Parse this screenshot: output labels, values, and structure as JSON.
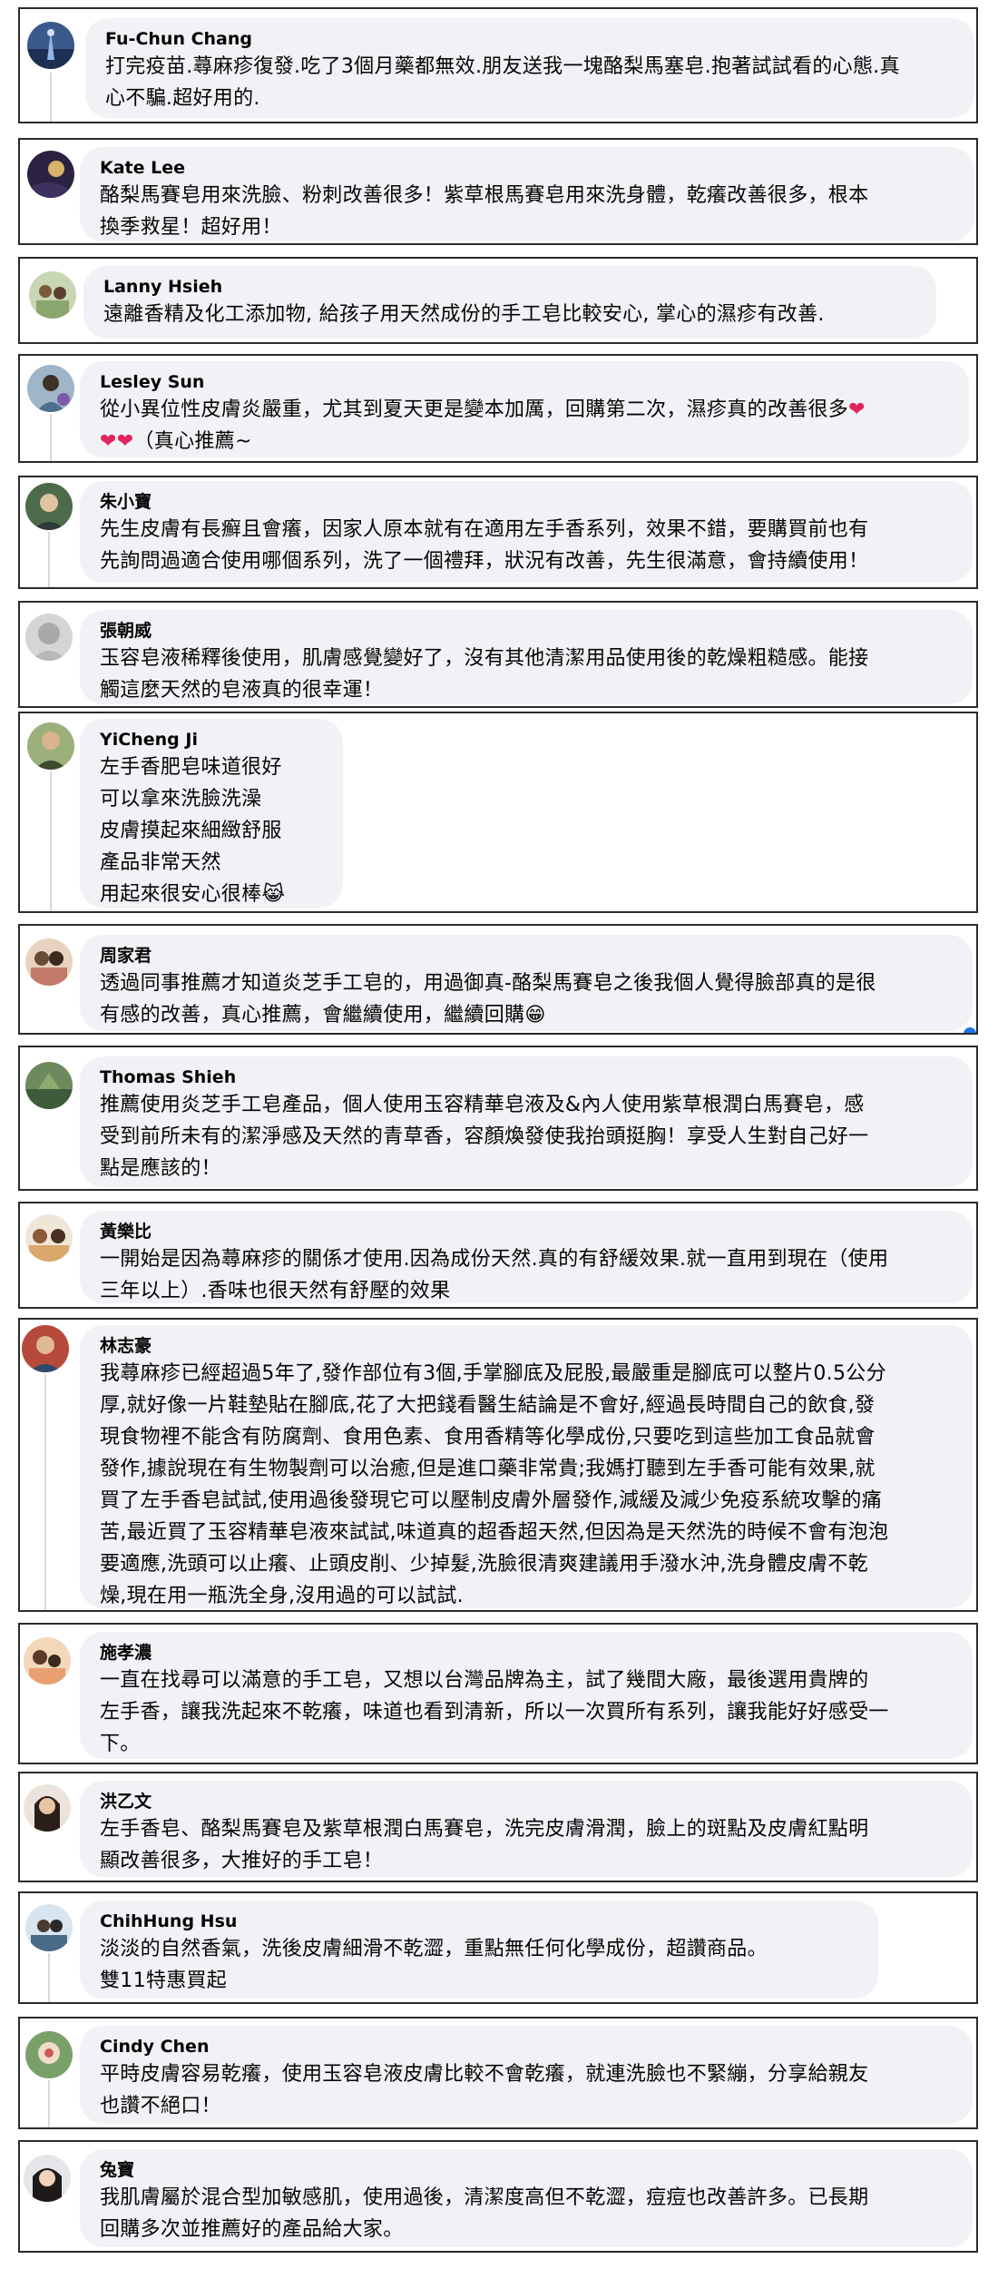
{
  "comments": [
    {
      "author": "Fu-Chun Chang",
      "text": "打完疫苗.蕁麻疹復發.吃了3個月藥都無效.朋友送我一塊酪梨馬塞皂.抱著試試看的心態.真\n心不騙.超好用的."
    },
    {
      "author": "Kate Lee",
      "text": "酪梨馬賽皂用來洗臉、粉刺改善很多！紫草根馬賽皂用來洗身體，乾癢改善很多，根本\n換季救星！超好用！"
    },
    {
      "author": "Lanny Hsieh",
      "text": "遠離香精及化工添加物, 給孩子用天然成份的手工皂比較安心, 掌心的濕疹有改善."
    },
    {
      "author": "Lesley Sun",
      "text": "從小異位性皮膚炎嚴重，尤其到夏天更是變本加厲，回購第二次，濕疹真的改善很多",
      "text2": "（真心推薦~"
    },
    {
      "author": "朱小寶",
      "text": "先生皮膚有長癬且會癢，因家人原本就有在適用左手香系列，效果不錯，要購買前也有\n先詢問過適合使用哪個系列，洗了一個禮拜，狀況有改善，先生很滿意，會持續使用！"
    },
    {
      "author": "張朝威",
      "text": "玉容皂液稀釋後使用，肌膚感覺變好了，沒有其他清潔用品使用後的乾燥粗糙感。能接\n觸這麼天然的皂液真的很幸運！"
    },
    {
      "author": "YiCheng Ji",
      "text": "左手香肥皂味道很好\n可以拿來洗臉洗澡\n皮膚摸起來細緻舒服\n產品非常天然\n用起來很安心很棒"
    },
    {
      "author": "周家君",
      "text": "透過同事推薦才知道炎芝手工皂的，用過御真-酪梨馬賽皂之後我個人覺得臉部真的是很\n有感的改善，真心推薦，會繼續使用，繼續回購"
    },
    {
      "author": "Thomas Shieh",
      "text": "推薦使用炎芝手工皂產品，個人使用玉容精華皂液及&內人使用紫草根潤白馬賽皂，感\n受到前所未有的潔淨感及天然的青草香，容顏煥發使我抬頭挺胸！享受人生對自己好一\n點是應該的！"
    },
    {
      "author": "黃樂比",
      "text": "一開始是因為蕁麻疹的關係才使用.因為成份天然.真的有舒緩效果.就一直用到現在（使用\n三年以上）.香味也很天然有舒壓的效果"
    },
    {
      "author": "林志豪",
      "text": "我蕁麻疹已經超過5年了,發作部位有3個,手掌腳底及屁股,最嚴重是腳底可以整片0.5公分\n厚,就好像一片鞋墊貼在腳底,花了大把錢看醫生結論是不會好,經過長時間自己的飲食,發\n現食物裡不能含有防腐劑、食用色素、食用香精等化學成份,只要吃到這些加工食品就會\n發作,據說現在有生物製劑可以治癒,但是進口藥非常貴;我媽打聽到左手香可能有效果,就\n買了左手香皂試試,使用過後發現它可以壓制皮膚外層發作,減緩及減少免疫系統攻擊的痛\n苦,最近買了玉容精華皂液來試試,味道真的超香超天然,但因為是天然洗的時候不會有泡泡\n要適應,洗頭可以止癢、止頭皮削、少掉髮,洗臉很清爽建議用手潑水沖,洗身體皮膚不乾\n燥,現在用一瓶洗全身,沒用過的可以試試."
    },
    {
      "author": "施孝濃",
      "text": "一直在找尋可以滿意的手工皂，又想以台灣品牌為主，試了幾間大廠，最後選用貴牌的\n左手香，讓我洗起來不乾癢，味道也看到清新，所以一次買所有系列，讓我能好好感受一\n下。"
    },
    {
      "author": "洪乙文",
      "text": "左手香皂、酪梨馬賽皂及紫草根潤白馬賽皂，洗完皮膚滑潤，臉上的斑點及皮膚紅點明\n顯改善很多，大推好的手工皂！"
    },
    {
      "author": "ChihHung Hsu",
      "text": "淡淡的自然香氣，洗後皮膚細滑不乾澀，重點無任何化學成份，超讚商品。\n雙11特惠買起"
    },
    {
      "author": "Cindy Chen",
      "text": "平時皮膚容易乾癢，使用玉容皂液皮膚比較不會乾癢，就連洗臉也不緊繃，分享給親友\n也讚不絕口！"
    },
    {
      "author": "兔寶",
      "text": "我肌膚屬於混合型加敏感肌，使用過後，清潔度高但不乾澀，痘痘也改善許多。已長期\n回購多次並推薦好的產品給大家。"
    }
  ],
  "emoji": {
    "heart": "❤",
    "laugh": "😹",
    "grin": "😁"
  },
  "colors": {
    "bubble": "#f0f2f5",
    "border": "#2b2b2b",
    "heart": "#e0245e"
  }
}
